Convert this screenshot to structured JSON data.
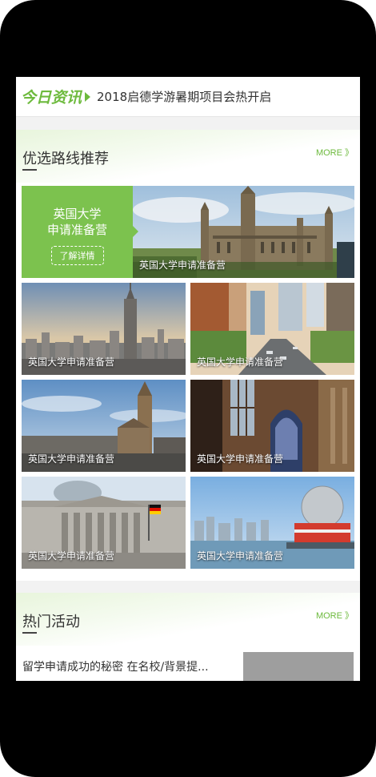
{
  "news": {
    "logo_text": "今日资讯",
    "headline": "2018启德学游暑期项目会热开启"
  },
  "routes": {
    "title": "优选路线推荐",
    "more": "MORE",
    "more_glyph": "》",
    "feature": {
      "panel_line1": "英国大学",
      "panel_line2": "申请准备营",
      "button": "了解详情",
      "caption": "英国大学申请准备营"
    },
    "tiles": [
      {
        "caption": "英国大学申请准备营",
        "scene": "city-skyline"
      },
      {
        "caption": "英国大学申请准备营",
        "scene": "city-street"
      },
      {
        "caption": "英国大学申请准备营",
        "scene": "gothic-tower"
      },
      {
        "caption": "英国大学申请准备营",
        "scene": "cathedral-interior"
      },
      {
        "caption": "英国大学申请准备营",
        "scene": "reichstag"
      },
      {
        "caption": "英国大学申请准备营",
        "scene": "harbor-dome"
      }
    ]
  },
  "events": {
    "title": "热门活动",
    "more": "MORE",
    "more_glyph": "》",
    "first_item": "留学申请成功的秘密 在名校/背景提..."
  },
  "colors": {
    "brand_green": "#6dba3d",
    "panel_green": "#7cc24e"
  }
}
